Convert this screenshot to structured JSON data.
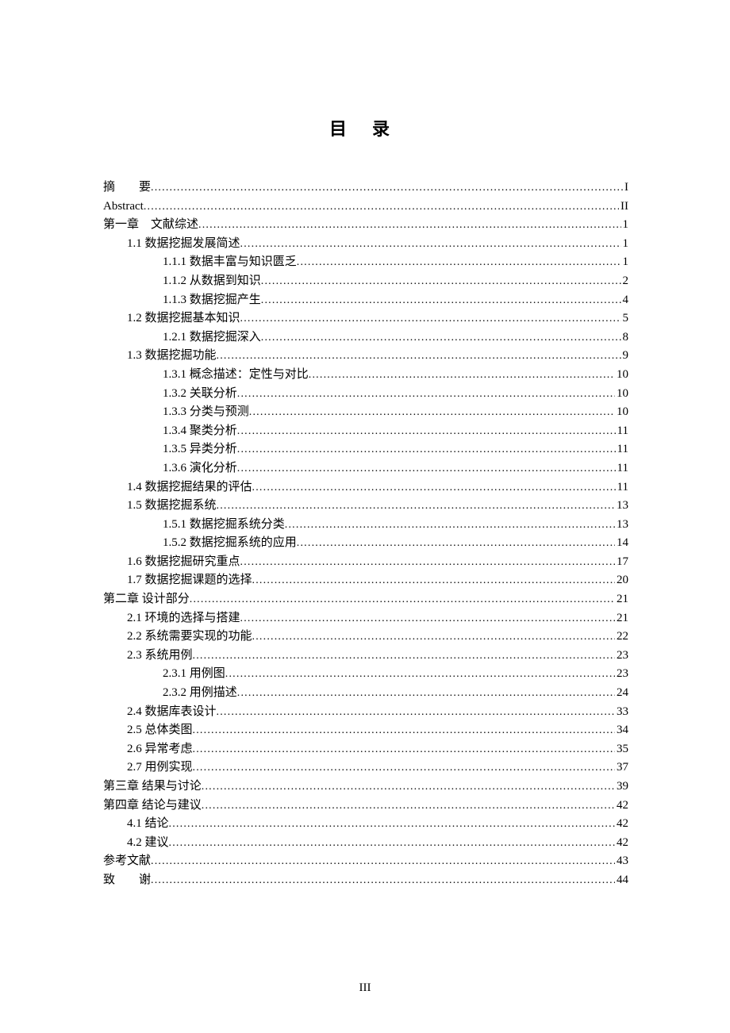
{
  "title": "目录",
  "page_footer": "III",
  "entries": [
    {
      "indent": 0,
      "label": "摘　　要",
      "page": "I"
    },
    {
      "indent": 0,
      "label": "Abstract",
      "page": "II"
    },
    {
      "indent": 0,
      "label": "第一章　文献综述",
      "page": "1"
    },
    {
      "indent": 1,
      "label": "1.1 数据挖掘发展简述",
      "page": "1"
    },
    {
      "indent": 2,
      "label": "1.1.1 数据丰富与知识匮乏",
      "page": "1"
    },
    {
      "indent": 2,
      "label": "1.1.2 从数据到知识",
      "page": "2"
    },
    {
      "indent": 2,
      "label": "1.1.3 数据挖掘产生",
      "page": "4"
    },
    {
      "indent": 1,
      "label": "1.2 数据挖掘基本知识",
      "page": "5"
    },
    {
      "indent": 2,
      "label": "1.2.1 数据挖掘深入",
      "page": "8"
    },
    {
      "indent": 1,
      "label": "1.3 数据挖掘功能",
      "page": "9"
    },
    {
      "indent": 2,
      "label": "1.3.1 概念描述：定性与对比",
      "page": "10"
    },
    {
      "indent": 2,
      "label": "1.3.2 关联分析",
      "page": "10"
    },
    {
      "indent": 2,
      "label": "1.3.3 分类与预测",
      "page": "10"
    },
    {
      "indent": 2,
      "label": "1.3.4 聚类分析",
      "page": "11"
    },
    {
      "indent": 2,
      "label": "1.3.5 异类分析",
      "page": "11"
    },
    {
      "indent": 2,
      "label": "1.3.6 演化分析",
      "page": "11"
    },
    {
      "indent": 1,
      "label": "1.4 数据挖掘结果的评估",
      "page": "11"
    },
    {
      "indent": 1,
      "label": "1.5 数据挖掘系统",
      "page": "13"
    },
    {
      "indent": 2,
      "label": "1.5.1 数据挖掘系统分类",
      "page": "13"
    },
    {
      "indent": 2,
      "label": "1.5.2 数据挖掘系统的应用",
      "page": "14"
    },
    {
      "indent": 1,
      "label": "1.6 数据挖掘研究重点",
      "page": "17"
    },
    {
      "indent": 1,
      "label": "1.7 数据挖掘课题的选择",
      "page": "20"
    },
    {
      "indent": 0,
      "label": "第二章 设计部分",
      "page": "21"
    },
    {
      "indent": 1,
      "label": "2.1 环境的选择与搭建",
      "page": "21"
    },
    {
      "indent": 1,
      "label": "2.2 系统需要实现的功能",
      "page": "22"
    },
    {
      "indent": 1,
      "label": "2.3 系统用例",
      "page": "23"
    },
    {
      "indent": 2,
      "label": "2.3.1 用例图",
      "page": "23"
    },
    {
      "indent": 2,
      "label": "2.3.2 用例描述",
      "page": "24"
    },
    {
      "indent": 1,
      "label": "2.4 数据库表设计",
      "page": "33"
    },
    {
      "indent": 1,
      "label": "2.5 总体类图",
      "page": "34"
    },
    {
      "indent": 1,
      "label": "2.6 异常考虑",
      "page": "35"
    },
    {
      "indent": 1,
      "label": "2.7 用例实现",
      "page": "37"
    },
    {
      "indent": 0,
      "label": "第三章 结果与讨论",
      "page": "39"
    },
    {
      "indent": 0,
      "label": "第四章 结论与建议",
      "page": "42"
    },
    {
      "indent": 1,
      "label": "4.1 结论",
      "page": "42"
    },
    {
      "indent": 1,
      "label": "4.2 建议",
      "page": "42"
    },
    {
      "indent": 0,
      "label": "参考文献",
      "page": "43"
    },
    {
      "indent": 0,
      "label": "致　　谢",
      "page": "44"
    }
  ]
}
